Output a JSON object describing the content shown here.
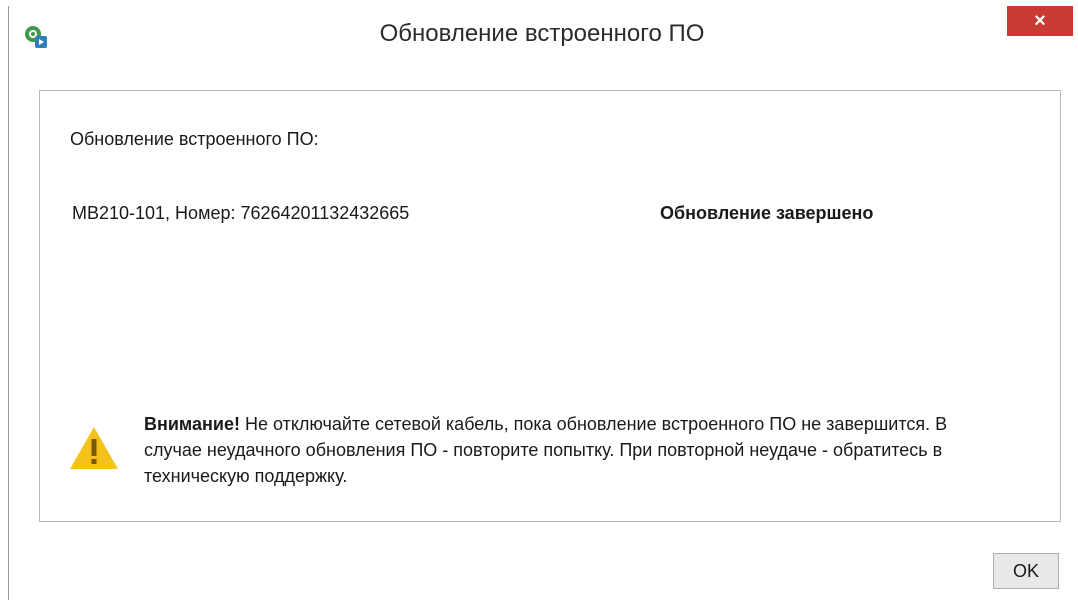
{
  "window": {
    "title": "Обновление встроенного ПО",
    "close_label": "×"
  },
  "content": {
    "section_label": "Обновление встроенного ПО:",
    "device": {
      "name": "МВ210-101, Номер: 76264201132432665",
      "status": "Обновление завершено"
    },
    "warning": {
      "title": "Внимание!",
      "text": " Не отключайте сетевой кабель, пока обновление встроенного ПО не завершится. В случае неудачного обновления ПО - повторите попытку. При повторной неудаче - обратитесь в техническую поддержку."
    }
  },
  "footer": {
    "ok_label": "OK"
  },
  "colors": {
    "close_button": "#c93a33",
    "warning_yellow": "#f5c21b",
    "app_icon_green": "#3a9a4a"
  },
  "icons": {
    "app": "app-icon",
    "close": "close-icon",
    "warning": "warning-icon"
  }
}
